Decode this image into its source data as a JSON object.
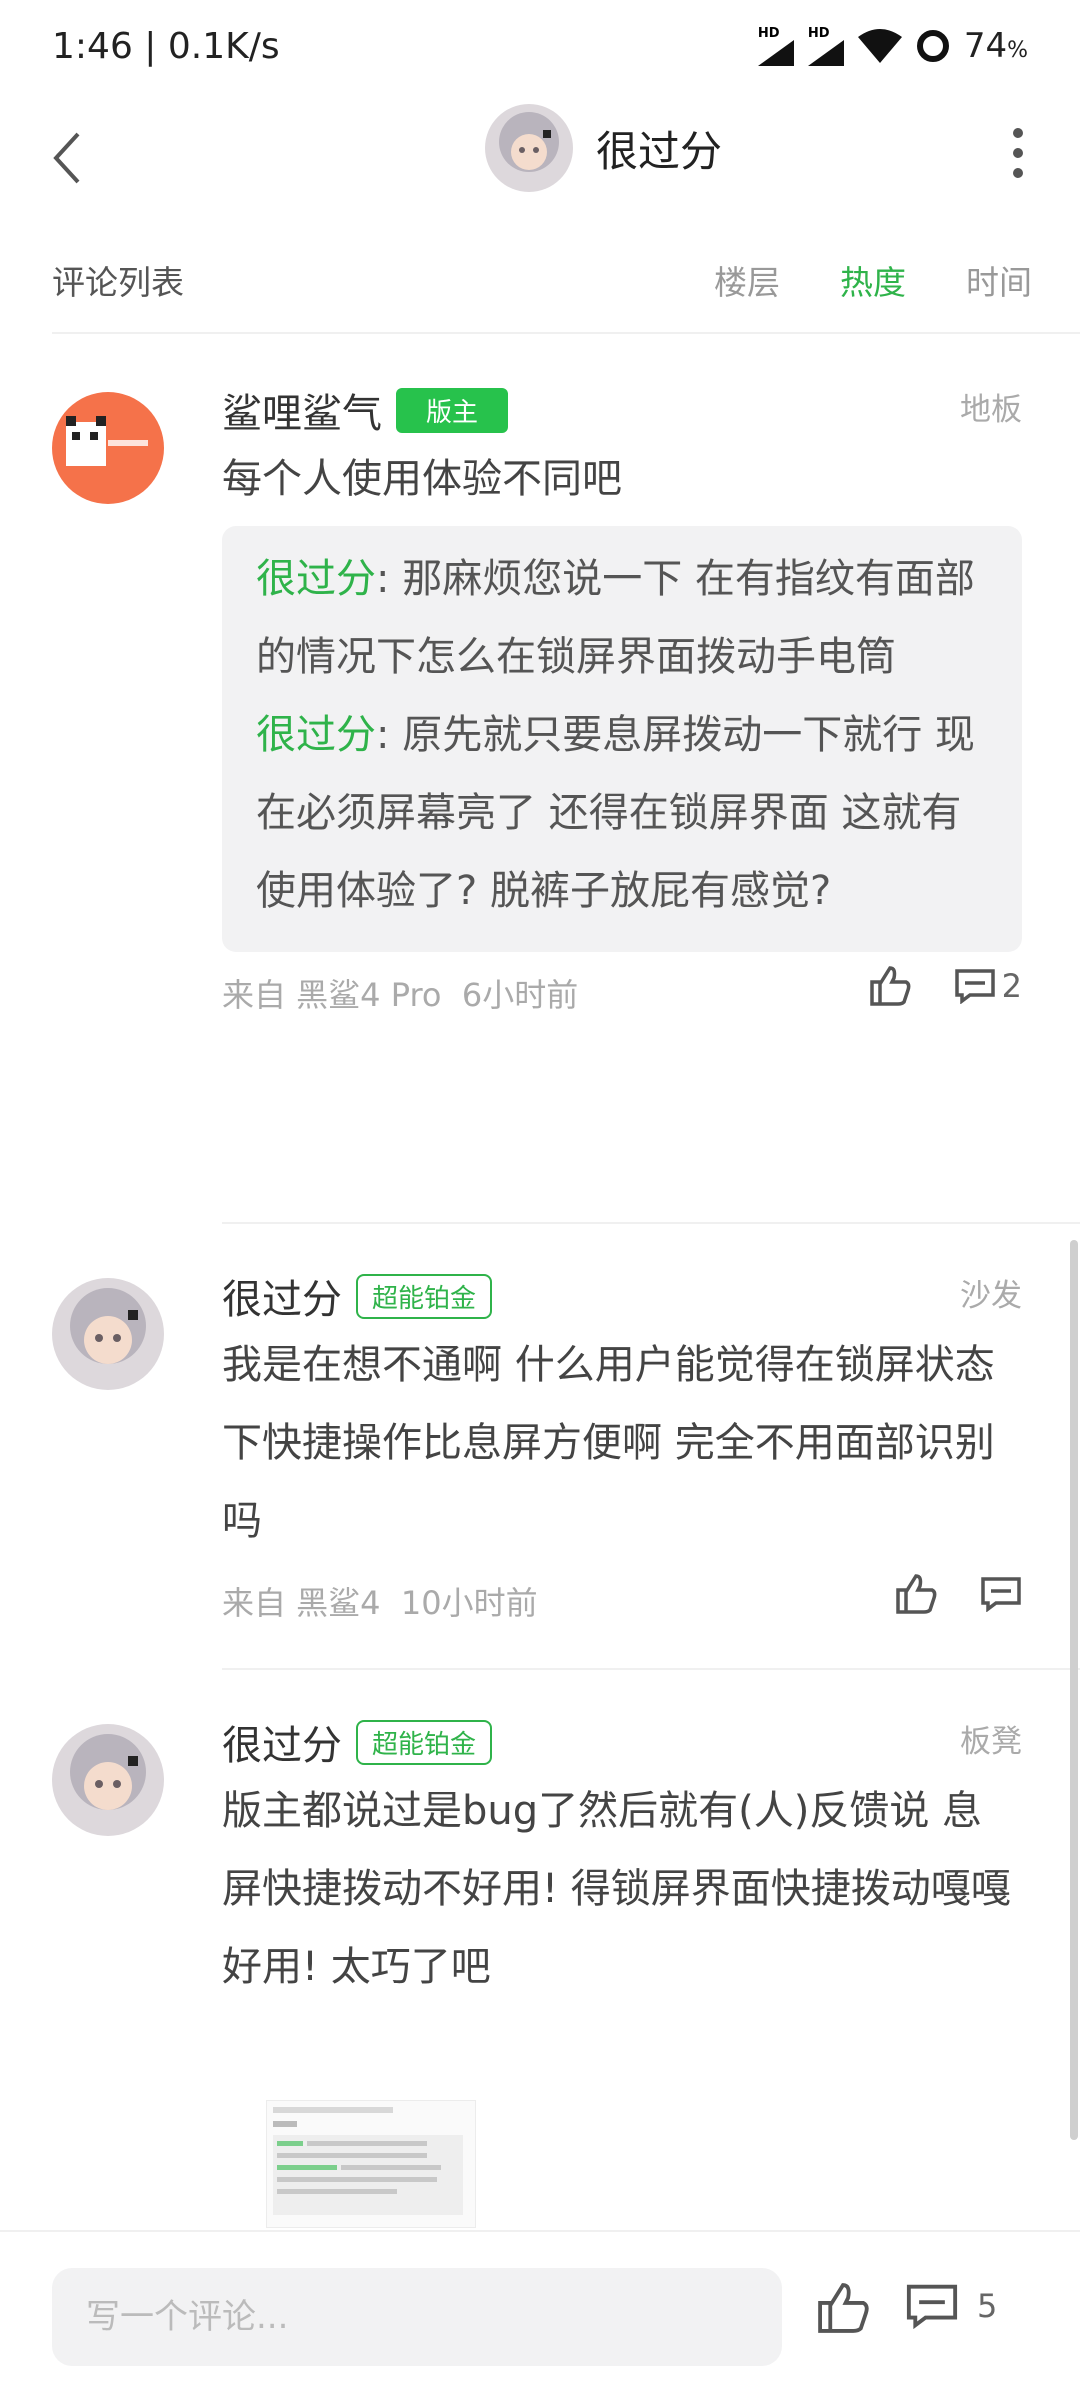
{
  "status": {
    "time": "1:46 | 0.1K/s",
    "battery": "74",
    "battery_unit": "%",
    "hd1": "HD",
    "hd2": "HD"
  },
  "header": {
    "title": "很过分"
  },
  "list": {
    "label": "评论列表",
    "sorts": [
      "楼层",
      "热度",
      "时间"
    ],
    "active_sort": "热度"
  },
  "comments": [
    {
      "name": "鲨哩鲨气",
      "badge": "版主",
      "floor": "地板",
      "text": "每个人使用体验不同吧",
      "quotes": [
        {
          "who": "很过分",
          "sep": ":",
          "text": "那麻烦您说一下 在有指纹有面部的情况下怎么在锁屏界面拨动手电筒"
        },
        {
          "who": "很过分",
          "sep": ":",
          "text": "原先就只要息屏拨动一下就行 现在必须屏幕亮了 还得在锁屏界面 这就有使用体验了? 脱裤子放屁有感觉?"
        }
      ],
      "source": "来自 黑鲨4 Pro",
      "time": "6小时前",
      "reply_count": "2"
    },
    {
      "name": "很过分",
      "badge": "超能铂金",
      "floor": "沙发",
      "text": "我是在想不通啊 什么用户能觉得在锁屏状态下快捷操作比息屏方便啊 完全不用面部识别吗",
      "source": "来自 黑鲨4",
      "time": "10小时前"
    },
    {
      "name": "很过分",
      "badge": "超能铂金",
      "floor": "板凳",
      "text": "版主都说过是bug了然后就有(人)反馈说 息屏快捷拨动不好用! 得锁屏界面快捷拨动嘎嘎好用! 太巧了吧"
    }
  ],
  "bottom": {
    "placeholder": "写一个评论...",
    "comment_count": "5"
  },
  "colors": {
    "accent": "#2fb34a",
    "badge_solid": "#27c24c"
  }
}
